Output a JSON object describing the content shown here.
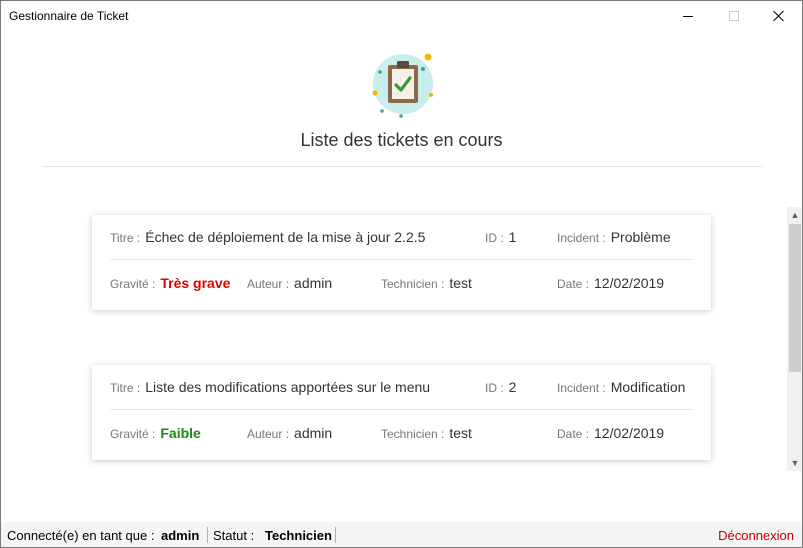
{
  "window": {
    "title": "Gestionnaire de Ticket"
  },
  "header": {
    "title": "Liste des tickets en cours",
    "icon": "clipboard-check-icon"
  },
  "labels": {
    "titre": "Titre :",
    "id": "ID :",
    "incident": "Incident :",
    "gravite": "Gravité :",
    "auteur": "Auteur :",
    "technicien": "Technicien :",
    "date": "Date :"
  },
  "tickets": [
    {
      "titre": "Échec de déploiement de la mise à jour 2.2.5",
      "id": "1",
      "incident": "Problème",
      "gravite": "Très grave",
      "auteur": "admin",
      "technicien": "test",
      "date": "12/02/2019"
    },
    {
      "titre": "Liste des modifications apportées sur le menu",
      "id": "2",
      "incident": "Modification",
      "gravite": "Faible",
      "auteur": "admin",
      "technicien": "test",
      "date": "12/02/2019"
    }
  ],
  "status": {
    "connected_label": "Connecté(e) en tant que :",
    "user": "admin",
    "status_label": "Statut :",
    "status_value": "Technicien",
    "logout": "Déconnexion"
  },
  "colors": {
    "severity_high": "#e00000",
    "severity_low": "#1a8a1a",
    "logout": "#c00000"
  }
}
